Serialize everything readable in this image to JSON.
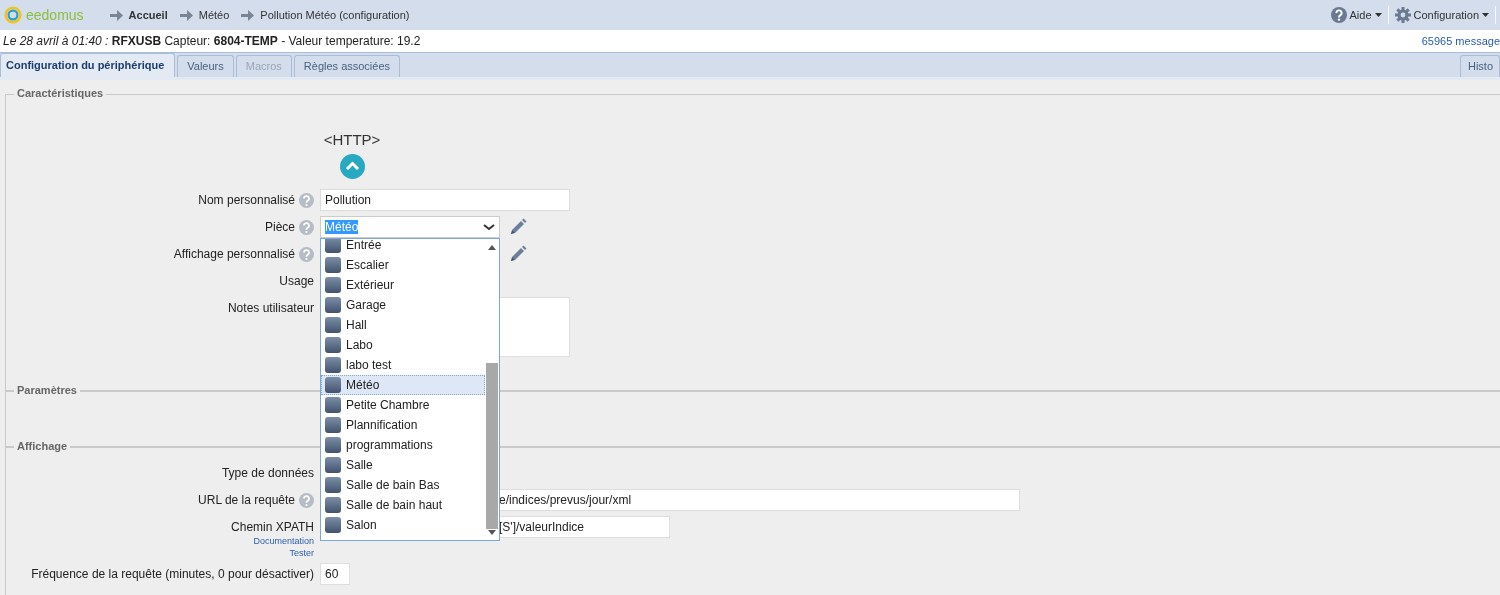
{
  "breadcrumb": {
    "logo": "eedomus",
    "items": [
      "Accueil",
      "Météo",
      "Pollution Météo (configuration)"
    ]
  },
  "header_menu": [
    {
      "label": "Aide",
      "kind": "help"
    },
    {
      "label": "Configuration",
      "kind": "gear"
    }
  ],
  "info_line": {
    "text": "*Le 28 avril à 01:40 :* **RFXUSB** Capteur: **6804-TEMP** - Valeur temperature: 19.2",
    "messages": "65965 message"
  },
  "tabs": [
    {
      "label": "Configuration du périphérique",
      "selected": true,
      "disabled": false
    },
    {
      "label": "Valeurs",
      "selected": false,
      "disabled": false
    },
    {
      "label": "Macros",
      "selected": false,
      "disabled": true
    },
    {
      "label": "Règles associées",
      "selected": false,
      "disabled": false
    }
  ],
  "right_tab": {
    "label": "Histo"
  },
  "sections": [
    {
      "title": "Caractéristiques",
      "device_type": "<HTTP>",
      "rows": [
        {
          "label": "Nom personnalisé",
          "help": true,
          "kind": "text",
          "value": "Pollution",
          "edit": false
        },
        {
          "label": "Pièce",
          "help": true,
          "kind": "select",
          "value": "Météo",
          "edit": true
        },
        {
          "label": "Affichage personnalisé",
          "help": true,
          "kind": "covered",
          "edit": true
        },
        {
          "label": "Usage",
          "help": false,
          "kind": "covered",
          "edit": false
        },
        {
          "label": "Notes utilisateur",
          "help": false,
          "kind": "textarea",
          "edit": false
        }
      ]
    },
    {
      "title": "Paramètres"
    },
    {
      "title": "Affichage",
      "rows": [
        {
          "label": "Type de données",
          "help": false,
          "kind": "covered",
          "edit": false
        },
        {
          "label": "URL de la requête",
          "help": true,
          "kind": "partial_wide",
          "value": "e/indices/prevus/jour/xml",
          "edit": false
        },
        {
          "label": "Chemin XPATH",
          "help": false,
          "kind": "partial",
          "value": "[S']/valeurIndice",
          "links": [
            "Documentation",
            "Tester"
          ],
          "edit": false
        },
        {
          "label": "Fréquence de la requête (minutes, 0 pour désactiver)",
          "help": false,
          "kind": "short",
          "value": "60",
          "edit": false
        }
      ]
    }
  ],
  "room_dropdown": {
    "items": [
      {
        "label": "Entrée",
        "selected": false
      },
      {
        "label": "Escalier",
        "selected": false
      },
      {
        "label": "Extérieur",
        "selected": false
      },
      {
        "label": "Garage",
        "selected": false
      },
      {
        "label": "Hall",
        "selected": false
      },
      {
        "label": "Labo",
        "selected": false
      },
      {
        "label": "labo test",
        "selected": false
      },
      {
        "label": "Météo",
        "selected": true
      },
      {
        "label": "Petite Chambre",
        "selected": false
      },
      {
        "label": "Plannification",
        "selected": false
      },
      {
        "label": "programmations",
        "selected": false
      },
      {
        "label": "Salle",
        "selected": false
      },
      {
        "label": "Salle de bain Bas",
        "selected": false
      },
      {
        "label": "Salle de bain haut",
        "selected": false
      },
      {
        "label": "Salon",
        "selected": false
      }
    ]
  }
}
